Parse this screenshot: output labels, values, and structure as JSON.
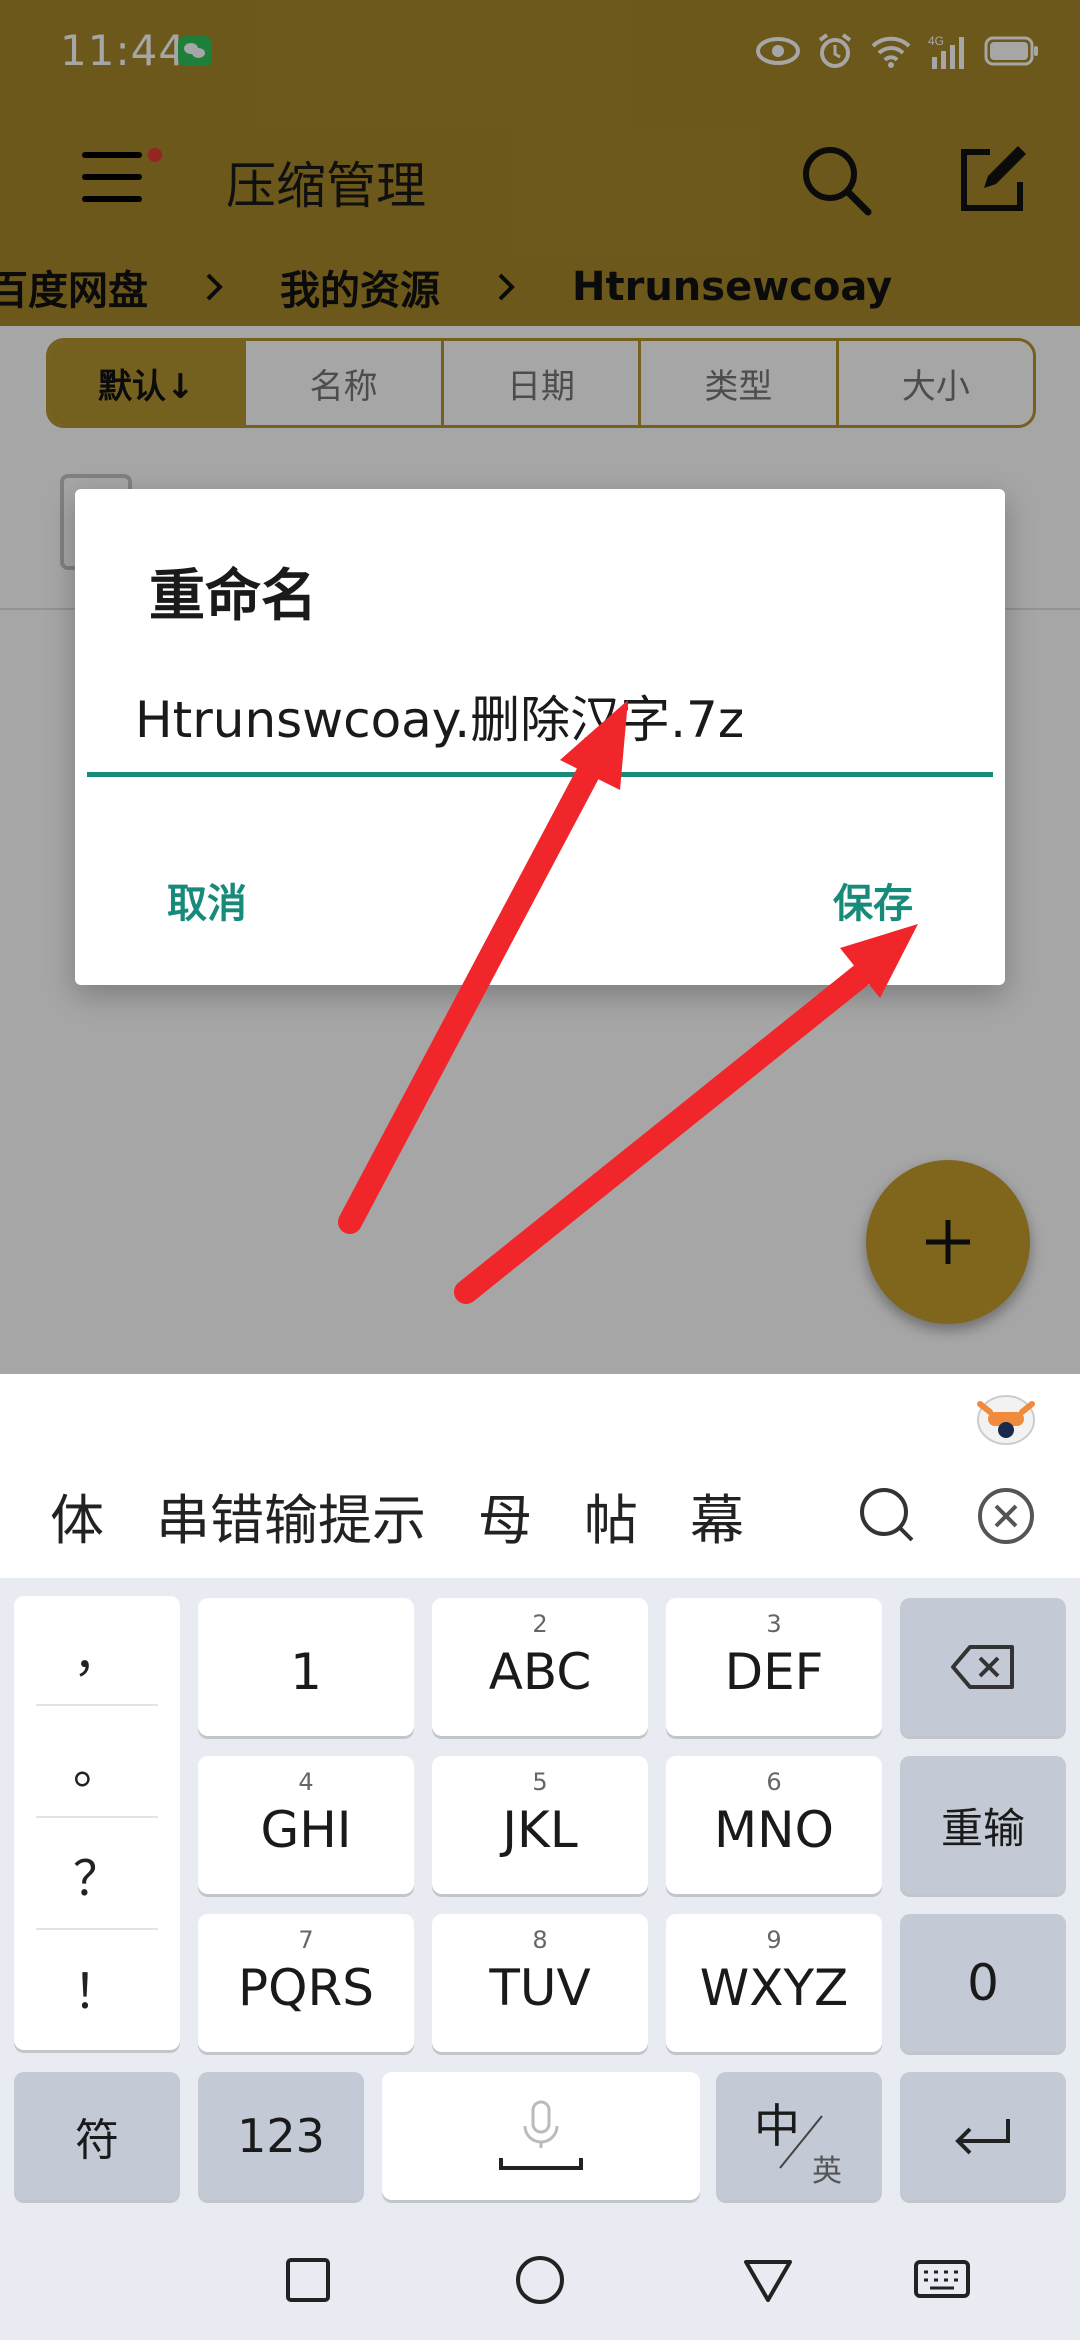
{
  "status_bar": {
    "time": "11:44",
    "network": "4G"
  },
  "app_bar": {
    "title": "压缩管理",
    "icons": [
      "menu-icon",
      "search-icon",
      "edit-icon"
    ]
  },
  "breadcrumb": [
    "百度网盘",
    "我的资源",
    "Htrunsewcoay"
  ],
  "sort_tabs": [
    {
      "label": "默认↓",
      "active": true
    },
    {
      "label": "名称",
      "active": false
    },
    {
      "label": "日期",
      "active": false
    },
    {
      "label": "类型",
      "active": false
    },
    {
      "label": "大小",
      "active": false
    }
  ],
  "dialog": {
    "title": "重命名",
    "input_value": "Htrunswcoay.删除汉字.7z",
    "cancel_label": "取消",
    "save_label": "保存"
  },
  "candidates": [
    "体",
    "串错输提示",
    "母",
    "帖",
    "幕"
  ],
  "keyboard": {
    "punctuation": [
      "，",
      "。",
      "？",
      "！"
    ],
    "rows": [
      [
        {
          "num": "",
          "label": "1"
        },
        {
          "num": "2",
          "label": "ABC"
        },
        {
          "num": "3",
          "label": "DEF"
        }
      ],
      [
        {
          "num": "4",
          "label": "GHI"
        },
        {
          "num": "5",
          "label": "JKL"
        },
        {
          "num": "6",
          "label": "MNO"
        }
      ],
      [
        {
          "num": "7",
          "label": "PQRS"
        },
        {
          "num": "8",
          "label": "TUV"
        },
        {
          "num": "9",
          "label": "WXYZ"
        }
      ]
    ],
    "reset_label": "重输",
    "zero_label": "0",
    "symbols_label": "符",
    "num_label": "123",
    "lang_main": "中",
    "lang_sub": "英"
  },
  "colors": {
    "accent": "#a78828",
    "teal": "#178a7a",
    "arrow": "#f0262b"
  }
}
